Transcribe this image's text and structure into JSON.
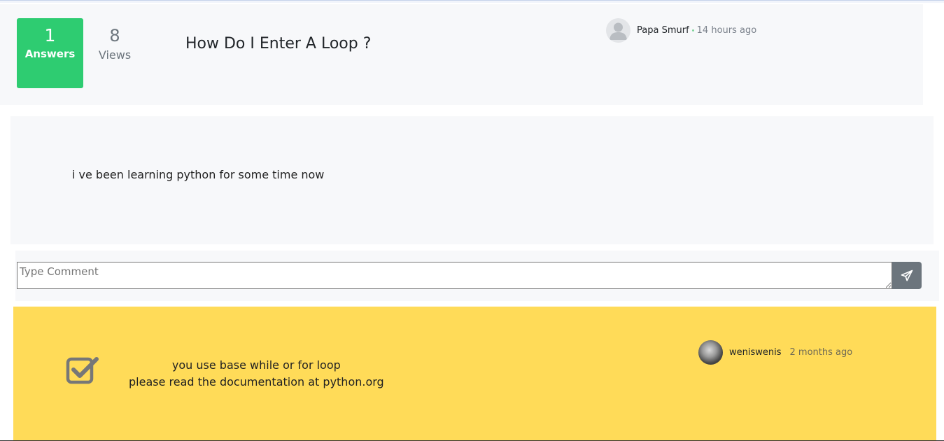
{
  "question": {
    "answers_count": "1",
    "answers_label": "Answers",
    "views_count": "8",
    "views_label": "Views",
    "title": "How Do I Enter A Loop ?",
    "author": "Papa Smurf",
    "time": "14 hours ago",
    "body": "i ve been learning python for some time now"
  },
  "comment": {
    "placeholder": "Type Comment",
    "send_icon": "paper-plane-icon"
  },
  "answer": {
    "accepted_icon": "check-square-icon",
    "line1": "you use base while or for loop",
    "line2": "please read the documentation at python.org",
    "author": "weniswenis",
    "time": "2 months ago",
    "background_color": "#ffdb58"
  },
  "colors": {
    "answers_green": "#2ecc71",
    "send_button": "#6c757d"
  }
}
